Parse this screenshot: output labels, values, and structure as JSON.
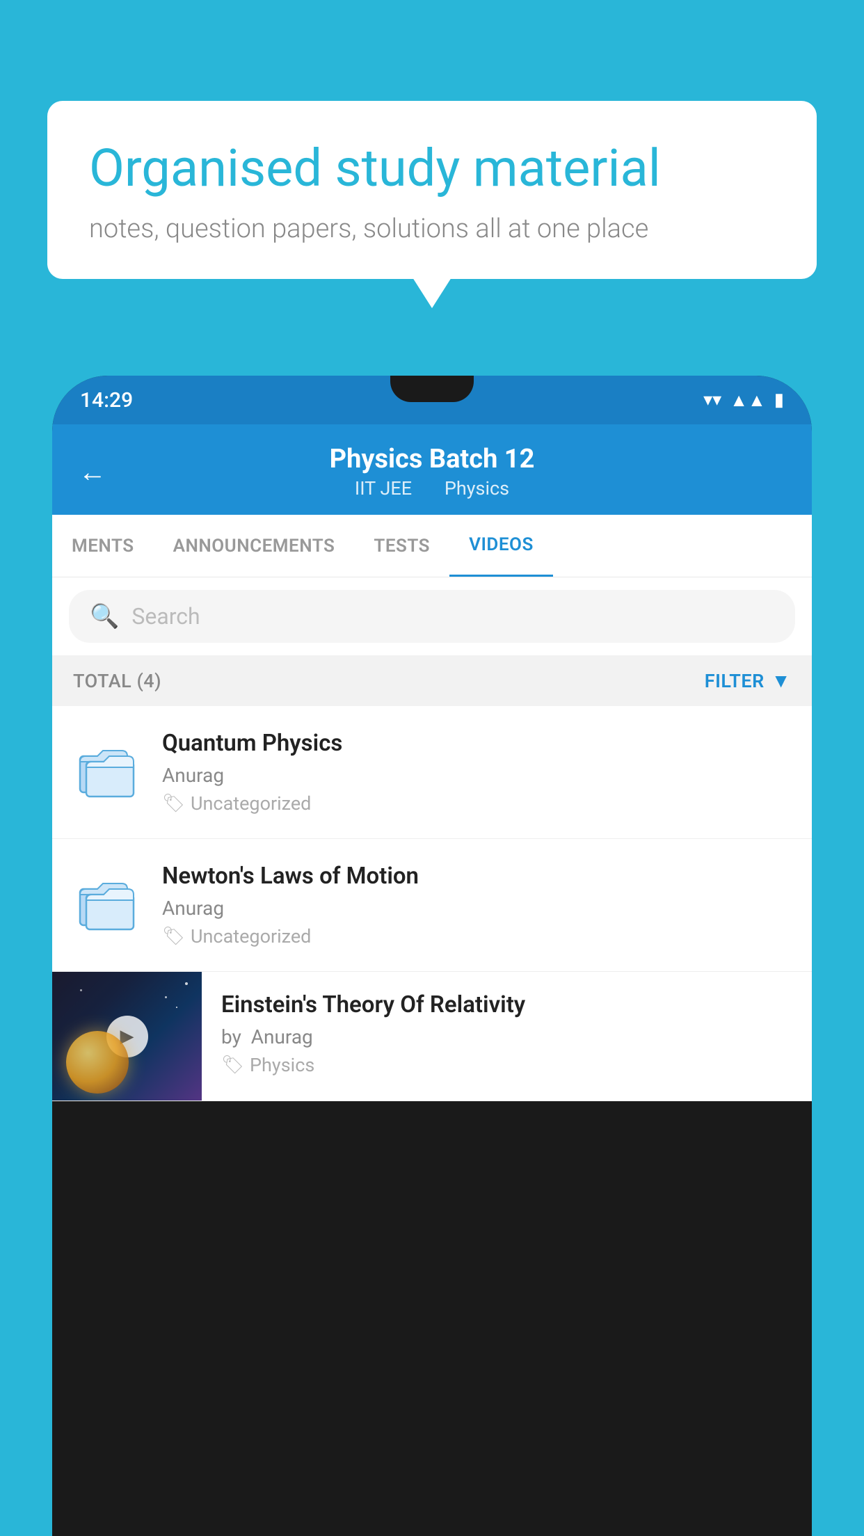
{
  "background_color": "#29b6d8",
  "speech_bubble": {
    "headline": "Organised study material",
    "subtext": "notes, question papers, solutions all at one place"
  },
  "phone": {
    "status_bar": {
      "time": "14:29",
      "wifi_icon": "wifi",
      "signal_icon": "signal",
      "battery_icon": "battery"
    },
    "app_header": {
      "back_label": "←",
      "title": "Physics Batch 12",
      "subtitle_part1": "IIT JEE",
      "subtitle_part2": "Physics"
    },
    "tabs": [
      {
        "id": "ments",
        "label": "MENTS",
        "active": false
      },
      {
        "id": "announcements",
        "label": "ANNOUNCEMENTS",
        "active": false
      },
      {
        "id": "tests",
        "label": "TESTS",
        "active": false
      },
      {
        "id": "videos",
        "label": "VIDEOS",
        "active": true
      }
    ],
    "search": {
      "placeholder": "Search"
    },
    "filter_row": {
      "total_label": "TOTAL (4)",
      "filter_label": "FILTER"
    },
    "videos": [
      {
        "id": "1",
        "title": "Quantum Physics",
        "author": "Anurag",
        "tag": "Uncategorized",
        "has_thumbnail": false
      },
      {
        "id": "2",
        "title": "Newton's Laws of Motion",
        "author": "Anurag",
        "tag": "Uncategorized",
        "has_thumbnail": false
      },
      {
        "id": "3",
        "title": "Einstein's Theory Of Relativity",
        "author_prefix": "by",
        "author": "Anurag",
        "tag": "Physics",
        "has_thumbnail": true
      }
    ]
  }
}
